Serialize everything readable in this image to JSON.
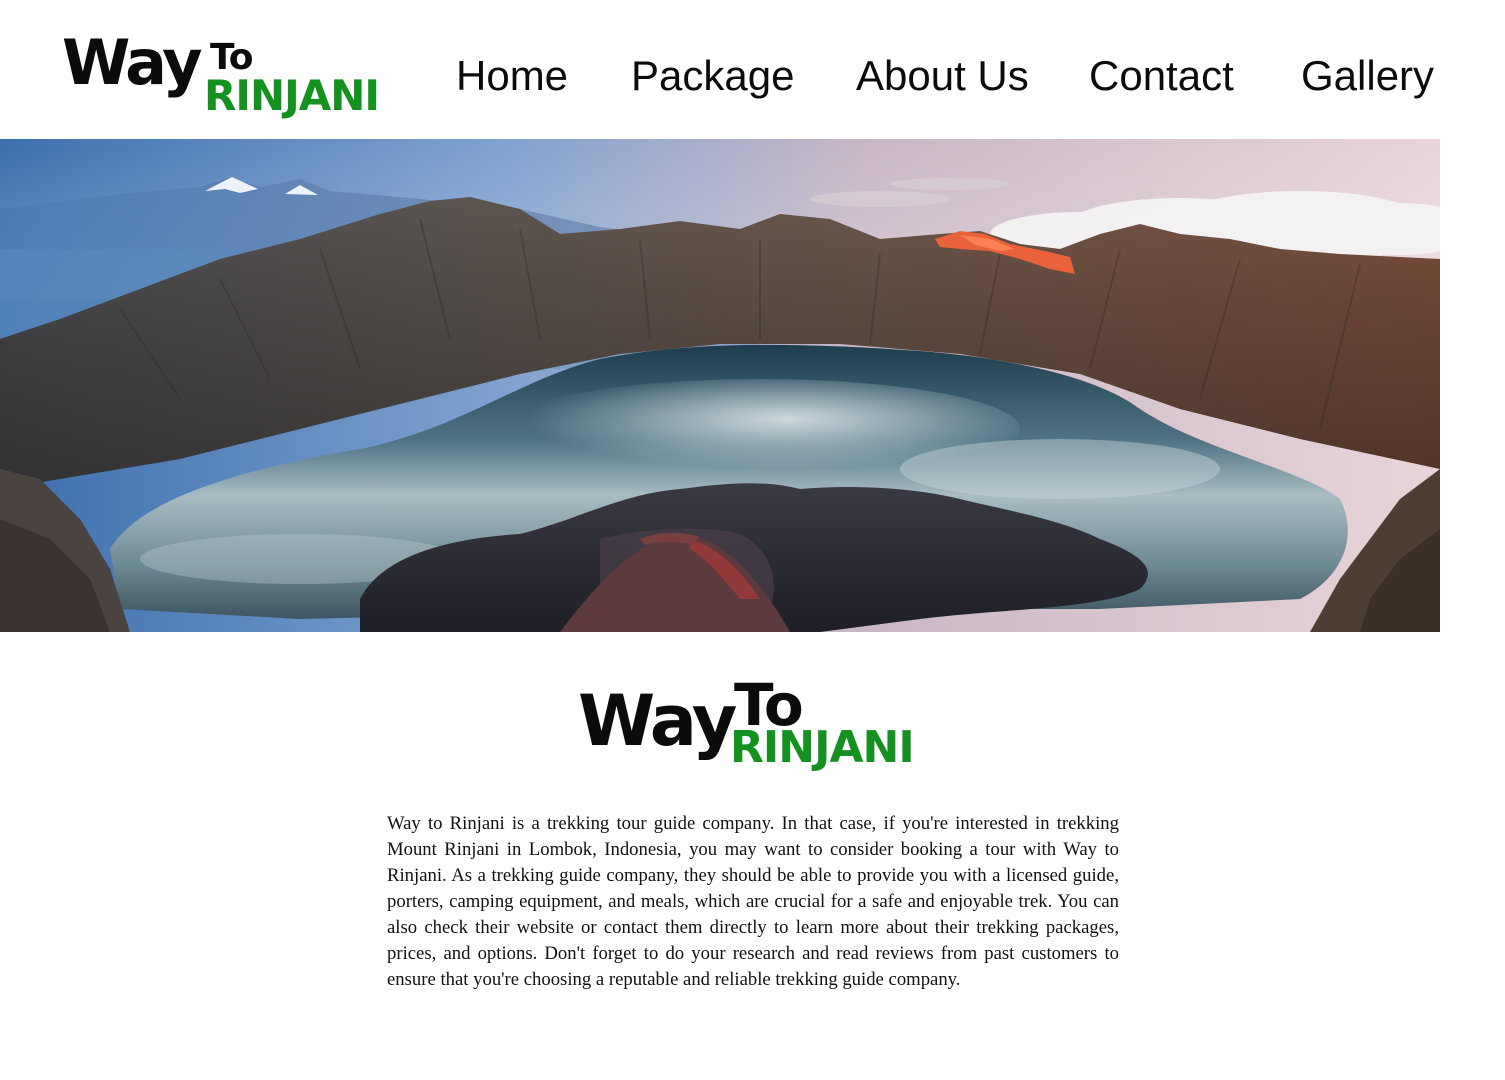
{
  "header": {
    "logo": {
      "way": "Way",
      "to": "To",
      "rinjani": "RINJANI"
    },
    "nav": [
      {
        "label": "Home"
      },
      {
        "label": "Package"
      },
      {
        "label": "About Us"
      },
      {
        "label": "Contact"
      },
      {
        "label": "Gallery"
      }
    ]
  },
  "hero": {
    "image": "Mount Rinjani crater lake panorama"
  },
  "about": {
    "logo": {
      "way": "Way",
      "to": "To",
      "rinjani": "RINJANI"
    },
    "description": "Way to Rinjani is a trekking tour guide company. In that case, if you're interested in trekking Mount Rinjani in Lombok, Indonesia, you may want to consider booking a tour with Way to Rinjani. As a trekking guide company, they should be able to provide you with a licensed guide, porters, camping equipment, and meals, which are crucial for a safe and enjoyable trek. You can also check their website or contact them directly to learn more about their trekking packages, prices, and options. Don't forget to do your research and read reviews from past customers to ensure that you're choosing a reputable and reliable trekking guide company."
  },
  "colors": {
    "brand_green": "#14911f",
    "text_dark": "#0b0b0b"
  }
}
